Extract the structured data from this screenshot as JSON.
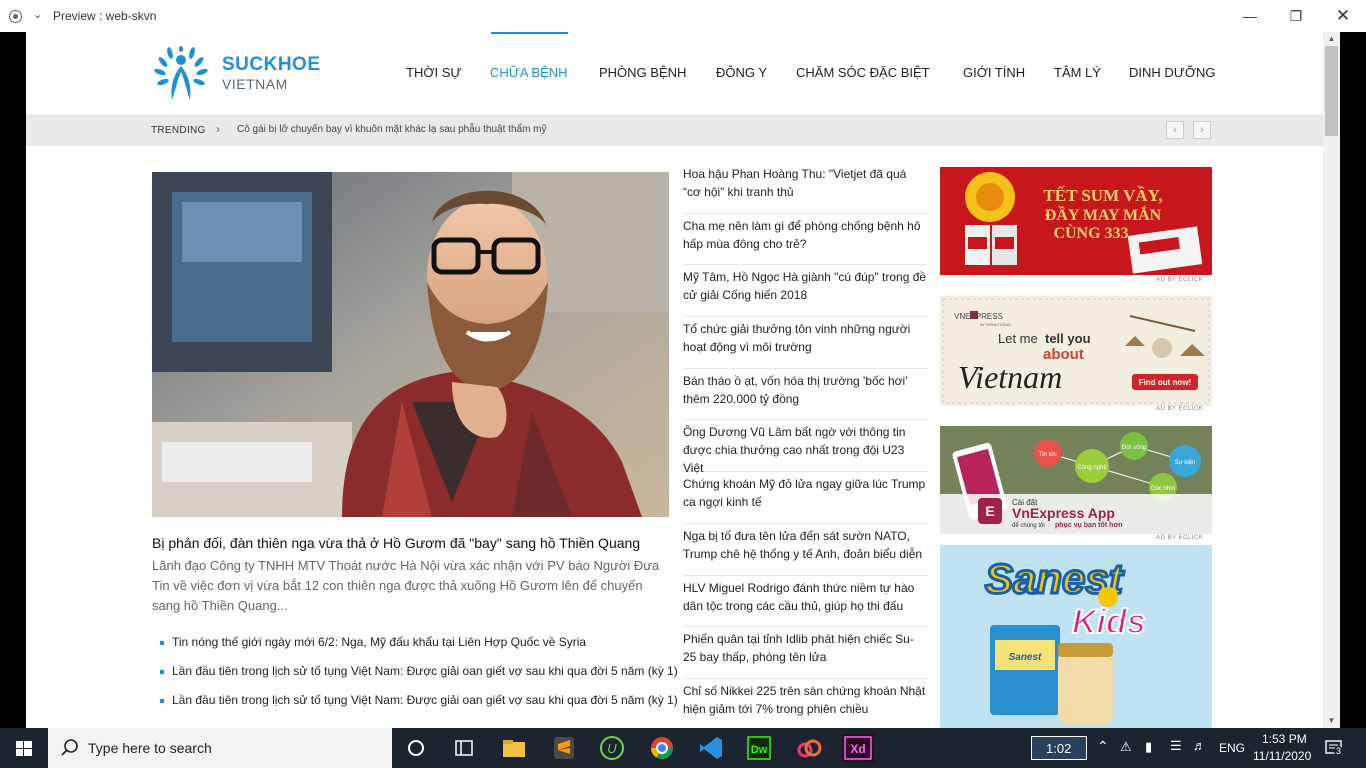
{
  "window": {
    "title": "Preview : web-skvn"
  },
  "logo": {
    "name": "SUCKHOE",
    "sub": "VIETNAM"
  },
  "nav": [
    "THỜI SỰ",
    "CHỮA BỆNH",
    "PHÒNG BỆNH",
    "ĐÔNG Y",
    "CHĂM SÓC ĐẶC BIỆT",
    "GIỚI TÍNH",
    "TÂM LÝ",
    "DINH DƯỠNG"
  ],
  "trending": {
    "label": "TRENDING",
    "text": "Cô gái bị lỡ chuyến bay vì khuôn mặt khác lạ sau phẫu thuật thẩm mỹ"
  },
  "featured": {
    "title": "Bị phản đối, đàn thiên nga vừa thả ở Hồ Gươm đã \"bay\" sang hồ Thiền Quang",
    "desc": "Lãnh đạo Công ty TNHH MTV Thoát nước Hà Nội vừa xác nhận với PV báo Người Đưa Tin về việc đơn vị vừa bắt 12 con thiên nga được thả xuống Hồ Gươm lên để chuyển sang hồ Thiền Quang...",
    "bullets": [
      "Tin nóng thế giới ngày mới 6/2: Nga, Mỹ đấu khẩu tại Liên Hợp Quốc về Syria",
      "Lần đầu tiên trong lịch sử tố tụng Việt Nam: Được giải oan giết vợ sau khi qua đời 5 năm (kỳ 1)",
      "Lần đầu tiên trong lịch sử tố tụng Việt Nam: Được giải oan giết vợ sau khi qua đời 5 năm (kỳ 1)"
    ]
  },
  "news": [
    "Hoa hậu Phan Hoàng Thu: \"Vietjet đã quá “cơ hội” khi tranh thủ",
    "Cha mẹ nên làm gì để phòng chống bệnh hô hấp mùa đông cho trẻ?",
    "Mỹ Tâm, Hồ Ngọc Hà giành \"cú đúp\" trong đề cử giải Cống hiến 2018",
    "Tổ chức giải thưởng tôn vinh những người hoạt động vì môi trường",
    "Bán tháo ồ ạt, vốn hóa thị trường 'bốc hơi' thêm 220.000 tỷ đồng",
    "Ông Dương Vũ Lâm bất ngờ với thông tin được chia thưởng cao nhất trong đội U23 Việt",
    "Chứng khoán Mỹ đỏ lửa ngay giữa lúc Trump ca ngợi kinh tế",
    "Nga bị tố đưa tên lửa đến sát sườn NATO, Trump chê hệ thống y tế Anh, đoản biểu diễn",
    "HLV Miguel Rodrigo đánh thức niềm tự hào dân tộc trong các cầu thủ, giúp họ thi đấu",
    "Phiến quân tại tỉnh Idlib phát hiện chiếc Su-25 bay thấp, phóng tên lửa",
    "Chỉ số Nikkei 225 trên sàn chứng khoán Nhật hiện giảm tới 7% trong phiên chiều"
  ],
  "ads": {
    "tag": "AD BY ECLICK",
    "ad1_line1": "TẾT SUM VẦY,",
    "ad1_line2": "ĐẦY MAY MẮN",
    "ad1_line3": "CÙNG 333",
    "ad2_brand": "VNEXPRESS",
    "ad2_brand_sub": "INTERNATIONAL",
    "ad2_text1": "Let me",
    "ad2_text2": "tell you",
    "ad2_text3": "about",
    "ad2_text4": "Vietnam",
    "ad2_cta": "Find out now!",
    "ad3_bubbles": [
      "Tin tức",
      "Đời sống",
      "Sự kiện",
      "Công nghệ",
      "Góc nhìn"
    ],
    "ad3_install": "Cài đặt",
    "ad3_app": "VnExpress App",
    "ad3_sub1": "để chúng tôi ",
    "ad3_sub2": "phục vụ bạn tốt hơn",
    "ad4_brand": "Sanest",
    "ad4_kids": "Kids",
    "ad4_label": "Sanest"
  },
  "taskbar": {
    "search_placeholder": "Type here to search",
    "clock": "1:02",
    "lang": "ENG",
    "time": "1:53 PM",
    "date": "11/11/2020",
    "notifications": "3",
    "apps": [
      "Task View",
      "File Explorer",
      "Sublime Text",
      "Upwork",
      "Chrome",
      "VS Code",
      "Dreamweaver",
      "Creative Cloud",
      "Adobe XD"
    ]
  }
}
